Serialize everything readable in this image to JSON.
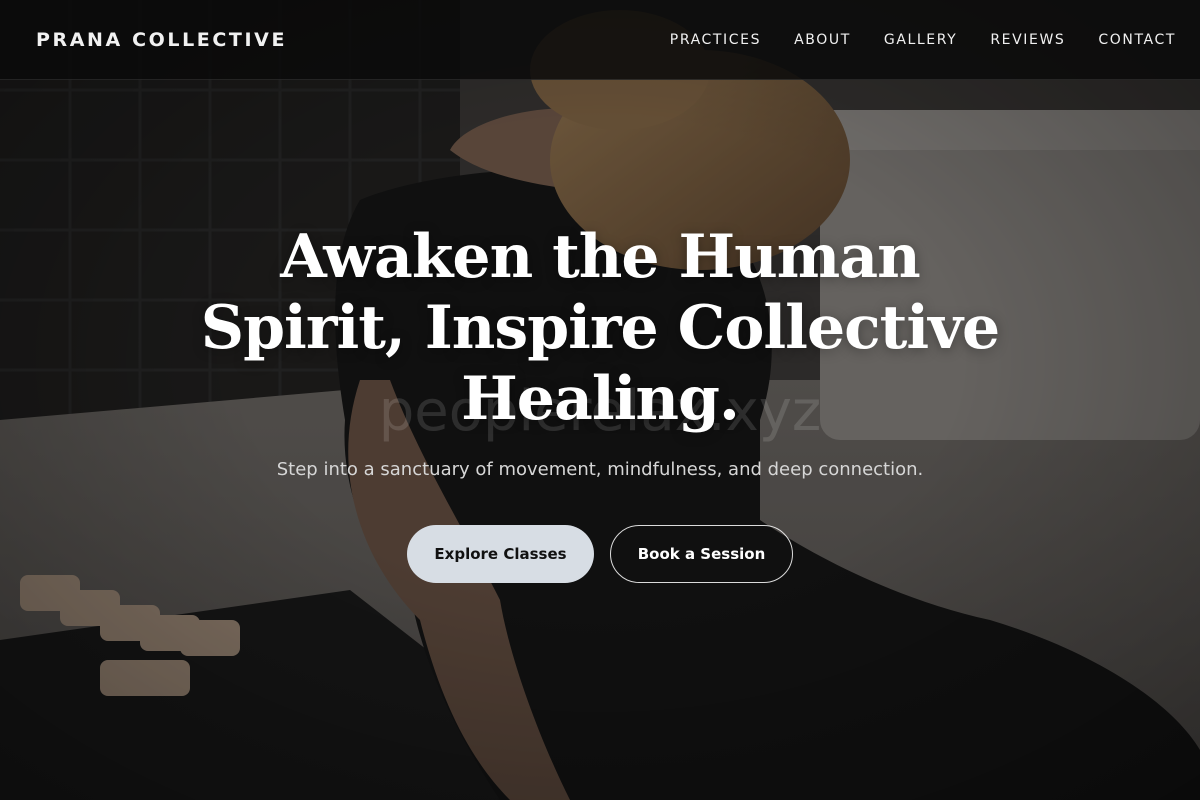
{
  "brand": {
    "name": "PRANA COLLECTIVE"
  },
  "nav": {
    "items": [
      {
        "label": "PRACTICES"
      },
      {
        "label": "ABOUT"
      },
      {
        "label": "GALLERY"
      },
      {
        "label": "REVIEWS"
      },
      {
        "label": "CONTACT"
      }
    ]
  },
  "hero": {
    "headline": "Awaken the Human Spirit, Inspire Collective Healing.",
    "subtitle": "Step into a sanctuary of movement, mindfulness, and deep connection.",
    "watermark": "peoplerelax.xyz",
    "primary_cta": "Explore Classes",
    "secondary_cta": "Book a Session",
    "image": "woman-yoga-stretch-photo"
  }
}
